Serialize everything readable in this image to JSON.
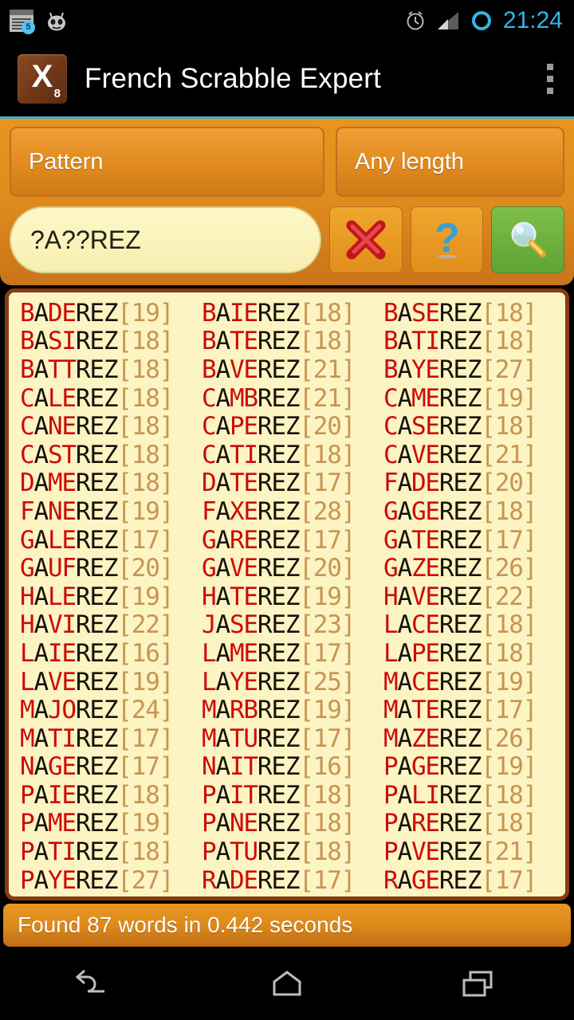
{
  "statusbar": {
    "clock": "21:24",
    "notification_badge": "5",
    "icons": [
      "news-notification-icon",
      "cyanogenmod-icon",
      "alarm-icon",
      "signal-icon",
      "battery-icon"
    ]
  },
  "titlebar": {
    "app_icon_letter": "X",
    "app_icon_score": "8",
    "title": "French Scrabble Expert",
    "overflow_label": "overflow-menu"
  },
  "controls": {
    "search_mode": "Pattern",
    "length_mode": "Any length",
    "pattern_value": "?A??REZ",
    "pattern_placeholder": "?A??REZ",
    "clear_button": "clear-icon",
    "help_button": "help-icon",
    "search_button": "search-icon"
  },
  "status": {
    "text": "Found 87 words in 0.442 seconds",
    "count": 87,
    "seconds": "0.442"
  },
  "navbar": {
    "back": "back-icon",
    "home": "home-icon",
    "recents": "recents-icon"
  },
  "colors": {
    "wildcard_letter": "#cc0b0b",
    "fixed_letter": "#17120c",
    "score": "#c79455",
    "panel_orange": "#e8941f",
    "list_background": "#fcf4c2",
    "list_border": "#8a3b10",
    "accent_cyan": "#33b5e5",
    "search_green": "#7fbf4a"
  },
  "results": {
    "pattern": "?A??REZ",
    "wildcard_positions": [
      0,
      2,
      3
    ],
    "columns": 3,
    "words": [
      {
        "word": "BADEREZ",
        "score": 19
      },
      {
        "word": "BAIEREZ",
        "score": 18
      },
      {
        "word": "BASEREZ",
        "score": 18
      },
      {
        "word": "BASIREZ",
        "score": 18
      },
      {
        "word": "BATEREZ",
        "score": 18
      },
      {
        "word": "BATIREZ",
        "score": 18
      },
      {
        "word": "BATTREZ",
        "score": 18
      },
      {
        "word": "BAVEREZ",
        "score": 21
      },
      {
        "word": "BAYEREZ",
        "score": 27
      },
      {
        "word": "CALEREZ",
        "score": 18
      },
      {
        "word": "CAMBREZ",
        "score": 21
      },
      {
        "word": "CAMEREZ",
        "score": 19
      },
      {
        "word": "CANEREZ",
        "score": 18
      },
      {
        "word": "CAPEREZ",
        "score": 20
      },
      {
        "word": "CASEREZ",
        "score": 18
      },
      {
        "word": "CASTREZ",
        "score": 18
      },
      {
        "word": "CATIREZ",
        "score": 18
      },
      {
        "word": "CAVEREZ",
        "score": 21
      },
      {
        "word": "DAMEREZ",
        "score": 18
      },
      {
        "word": "DATEREZ",
        "score": 17
      },
      {
        "word": "FADEREZ",
        "score": 20
      },
      {
        "word": "FANEREZ",
        "score": 19
      },
      {
        "word": "FAXEREZ",
        "score": 28
      },
      {
        "word": "GAGEREZ",
        "score": 18
      },
      {
        "word": "GALEREZ",
        "score": 17
      },
      {
        "word": "GAREREZ",
        "score": 17
      },
      {
        "word": "GATEREZ",
        "score": 17
      },
      {
        "word": "GAUFREZ",
        "score": 20
      },
      {
        "word": "GAVEREZ",
        "score": 20
      },
      {
        "word": "GAZEREZ",
        "score": 26
      },
      {
        "word": "HALEREZ",
        "score": 19
      },
      {
        "word": "HATEREZ",
        "score": 19
      },
      {
        "word": "HAVEREZ",
        "score": 22
      },
      {
        "word": "HAVIREZ",
        "score": 22
      },
      {
        "word": "JASEREZ",
        "score": 23
      },
      {
        "word": "LACEREZ",
        "score": 18
      },
      {
        "word": "LAIEREZ",
        "score": 16
      },
      {
        "word": "LAMEREZ",
        "score": 17
      },
      {
        "word": "LAPEREZ",
        "score": 18
      },
      {
        "word": "LAVEREZ",
        "score": 19
      },
      {
        "word": "LAYEREZ",
        "score": 25
      },
      {
        "word": "MACEREZ",
        "score": 19
      },
      {
        "word": "MAJOREZ",
        "score": 24
      },
      {
        "word": "MARBREZ",
        "score": 19
      },
      {
        "word": "MATEREZ",
        "score": 17
      },
      {
        "word": "MATIREZ",
        "score": 17
      },
      {
        "word": "MATUREZ",
        "score": 17
      },
      {
        "word": "MAZEREZ",
        "score": 26
      },
      {
        "word": "NAGEREZ",
        "score": 17
      },
      {
        "word": "NAITREZ",
        "score": 16
      },
      {
        "word": "PAGEREZ",
        "score": 19
      },
      {
        "word": "PAIEREZ",
        "score": 18
      },
      {
        "word": "PAITREZ",
        "score": 18
      },
      {
        "word": "PALIREZ",
        "score": 18
      },
      {
        "word": "PAMEREZ",
        "score": 19
      },
      {
        "word": "PANEREZ",
        "score": 18
      },
      {
        "word": "PAREREZ",
        "score": 18
      },
      {
        "word": "PATIREZ",
        "score": 18
      },
      {
        "word": "PATUREZ",
        "score": 18
      },
      {
        "word": "PAVEREZ",
        "score": 21
      },
      {
        "word": "PAYEREZ",
        "score": 27
      },
      {
        "word": "RADEREZ",
        "score": 17
      },
      {
        "word": "RAGEREZ",
        "score": 17
      }
    ]
  }
}
